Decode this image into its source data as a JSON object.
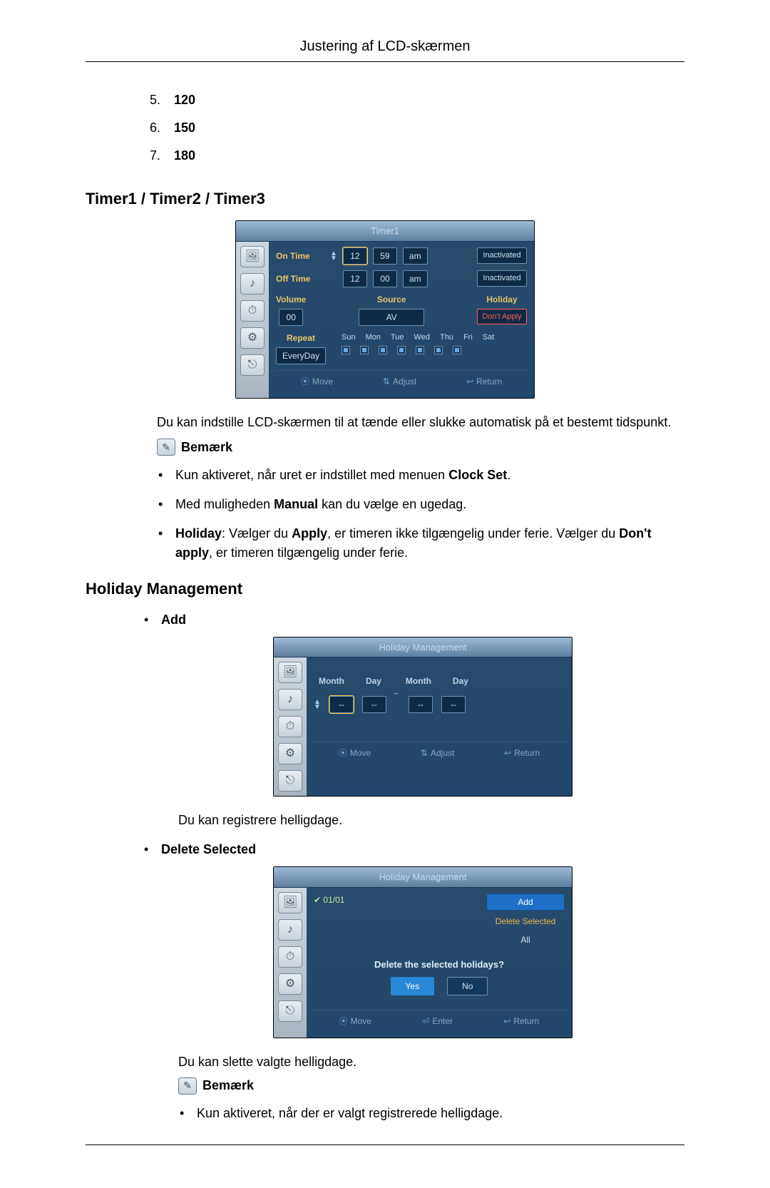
{
  "page_header": "Justering af LCD-skærmen",
  "num_list": [
    {
      "n": "5.",
      "v": "120"
    },
    {
      "n": "6.",
      "v": "150"
    },
    {
      "n": "7.",
      "v": "180"
    }
  ],
  "sections": {
    "timer_title": "Timer1 / Timer2 / Timer3",
    "holiday_title": "Holiday Management"
  },
  "timer_osd": {
    "title": "Timer1",
    "on_time": {
      "label": "On Time",
      "hh": "12",
      "mm": "59",
      "ampm": "am",
      "status": "Inactivated"
    },
    "off_time": {
      "label": "Off Time",
      "hh": "12",
      "mm": "00",
      "ampm": "am",
      "status": "Inactivated"
    },
    "volume": {
      "label": "Volume",
      "val": "00"
    },
    "source": {
      "label": "Source",
      "val": "AV"
    },
    "holiday": {
      "label": "Holiday",
      "val": "Don't Apply"
    },
    "repeat": {
      "label": "Repeat",
      "val": "EveryDay"
    },
    "days": [
      "Sun",
      "Mon",
      "Tue",
      "Wed",
      "Thu",
      "Fri",
      "Sat"
    ],
    "footer": {
      "move": "Move",
      "adjust": "Adjust",
      "return": "Return"
    }
  },
  "timer_para": "Du kan indstille LCD-skærmen til at tænde eller slukke automatisk på et bestemt tidspunkt.",
  "note_label": "Bemærk",
  "timer_notes": {
    "b1_a": "Kun aktiveret, når uret er indstillet med menuen ",
    "b1_bold": "Clock Set",
    "b1_b": ".",
    "b2_a": "Med muligheden ",
    "b2_bold": "Manual",
    "b2_b": " kan du vælge en ugedag.",
    "b3_a": "Holiday",
    "b3_b": ": Vælger du ",
    "b3_c": "Apply",
    "b3_d": ", er timeren ikke tilgængelig under ferie. Vælger du ",
    "b3_e": "Don't apply",
    "b3_f": ", er timeren tilgængelig under ferie."
  },
  "holiday": {
    "add_label": "Add",
    "add_osd": {
      "title": "Holiday Management",
      "month": "Month",
      "day": "Day",
      "dash": "--",
      "tilde": "~",
      "footer": {
        "move": "Move",
        "adjust": "Adjust",
        "return": "Return"
      }
    },
    "add_para": "Du kan registrere helligdage.",
    "delete_label": "Delete Selected",
    "delete_osd": {
      "title": "Holiday Management",
      "date": "01/01",
      "menu": {
        "add": "Add",
        "del": "Delete Selected",
        "all": "All"
      },
      "confirm": "Delete the selected holidays?",
      "yes": "Yes",
      "no": "No",
      "footer": {
        "move": "Move",
        "enter": "Enter",
        "return": "Return"
      }
    },
    "delete_para": "Du kan slette valgte helligdage.",
    "delete_note": "Kun aktiveret, når der er valgt registrerede helligdage."
  }
}
